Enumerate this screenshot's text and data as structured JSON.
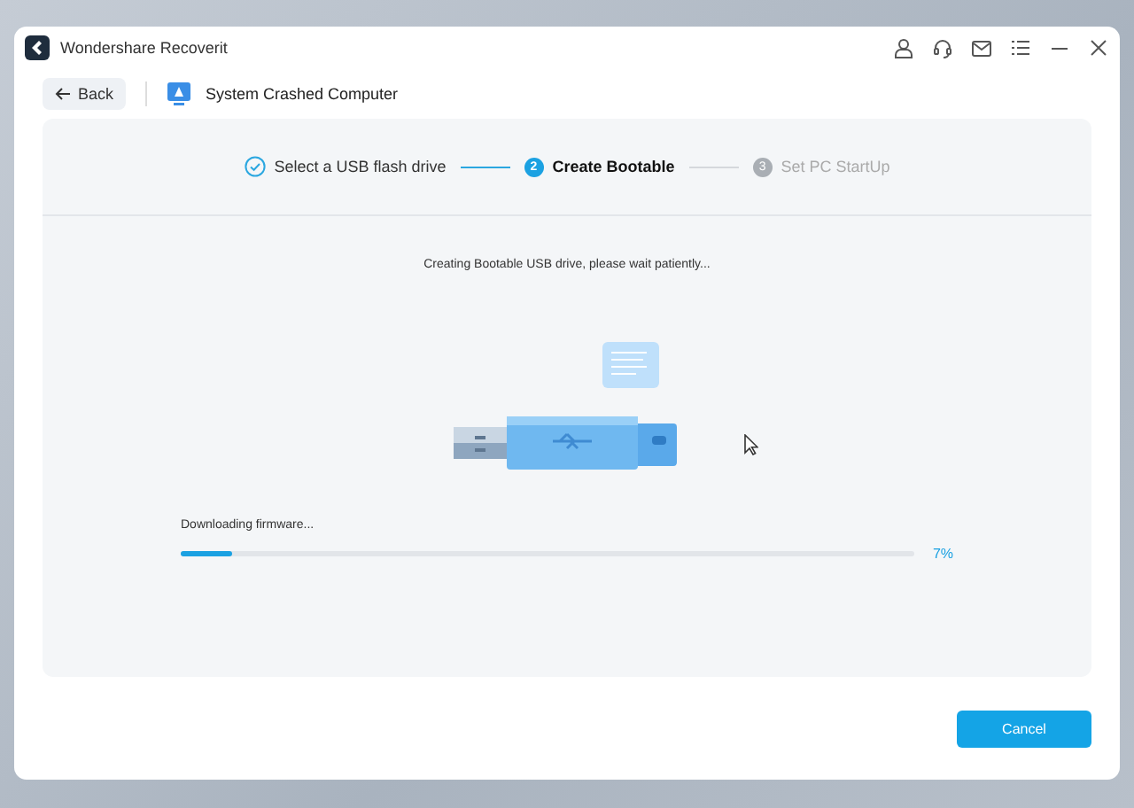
{
  "window": {
    "title": "Wondershare Recoverit"
  },
  "nav": {
    "back": "Back",
    "page_title": "System Crashed Computer"
  },
  "steps": [
    {
      "label": "Select a USB flash drive",
      "completed": true,
      "selected": false
    },
    {
      "number": "2",
      "label": "Create Bootable",
      "completed": false,
      "selected": true
    },
    {
      "number": "3",
      "label": "Set PC StartUp",
      "completed": false,
      "selected": false
    }
  ],
  "message": "Creating Bootable USB drive, please wait patiently...",
  "progress": {
    "label": "Downloading firmware...",
    "level": 0.07,
    "reading": "7%"
  },
  "buttons": {
    "cancel": "Cancel"
  }
}
